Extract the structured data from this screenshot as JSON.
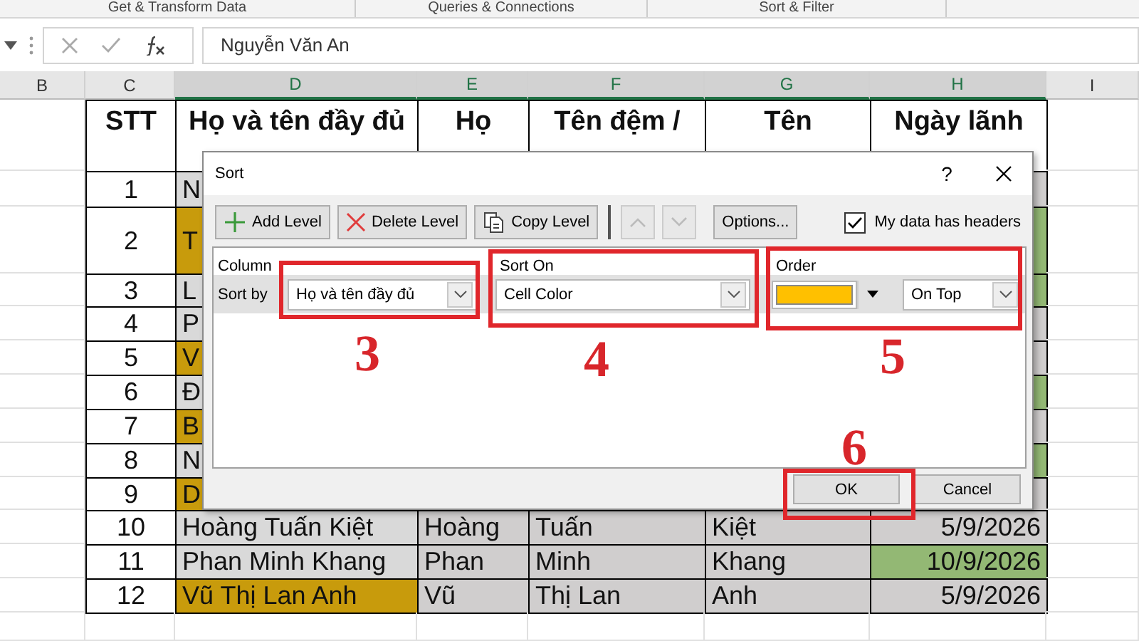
{
  "ribbon_groups": [
    "Get & Transform Data",
    "Queries & Connections",
    "Sort & Filter"
  ],
  "formula_bar": {
    "value": "Nguyễn Văn An"
  },
  "column_headers": [
    "B",
    "C",
    "D",
    "E",
    "F",
    "G",
    "H",
    "I"
  ],
  "table": {
    "header": [
      "STT",
      "Họ và tên đầy đủ",
      "Họ",
      "Tên đệm /",
      "Tên",
      "Ngày lãnh"
    ],
    "rows": [
      {
        "stt": "1",
        "name": {
          "text": "N",
          "color": "#d9d9d9"
        },
        "date": {
          "color": "#d0cece"
        }
      },
      {
        "stt": "2",
        "name": {
          "text": "T",
          "color": "#c89b0c"
        },
        "date": {
          "color": "#93b874"
        }
      },
      {
        "stt": "3",
        "name": {
          "text": "L",
          "color": "#d9d9d9"
        },
        "date": {
          "color": "#93b874"
        }
      },
      {
        "stt": "4",
        "name": {
          "text": "P",
          "color": "#d9d9d9"
        },
        "date": {
          "color": "#d0cece"
        }
      },
      {
        "stt": "5",
        "name": {
          "text": "V",
          "color": "#c89b0c"
        },
        "date": {
          "color": "#d0cece"
        }
      },
      {
        "stt": "6",
        "name": {
          "text": "Đ",
          "color": "#d9d9d9"
        },
        "date": {
          "color": "#93b874"
        }
      },
      {
        "stt": "7",
        "name": {
          "text": "B",
          "color": "#c89b0c"
        },
        "date": {
          "color": "#d0cece"
        }
      },
      {
        "stt": "8",
        "name": {
          "text": "N",
          "color": "#d9d9d9"
        },
        "date": {
          "color": "#93b874"
        }
      },
      {
        "stt": "9",
        "name": {
          "text": "D",
          "color": "#c89b0c"
        },
        "date": {
          "color": "#d0cece"
        }
      },
      {
        "stt": "10",
        "name": {
          "text": "Hoàng Tuấn Kiệt",
          "color": "#d9d9d9"
        },
        "ho": "Hoàng",
        "ten_dem": "Tuấn",
        "ten": "Kiệt",
        "date": {
          "text": "5/9/2026",
          "color": "#d0cece"
        }
      },
      {
        "stt": "11",
        "name": {
          "text": "Phan Minh Khang",
          "color": "#d9d9d9"
        },
        "ho": "Phan",
        "ten_dem": "Minh",
        "ten": "Khang",
        "date": {
          "text": "10/9/2026",
          "color": "#93b874"
        }
      },
      {
        "stt": "12",
        "name": {
          "text": "Vũ Thị Lan Anh",
          "color": "#c89b0c"
        },
        "ho": "Vũ",
        "ten_dem": "Thị Lan",
        "ten": "Anh",
        "date": {
          "text": "5/9/2026",
          "color": "#d0cece"
        }
      }
    ]
  },
  "sort_dialog": {
    "title": "Sort",
    "help": "?",
    "buttons": [
      {
        "kind": "add",
        "label": "Add Level"
      },
      {
        "kind": "delete",
        "label": "Delete Level"
      },
      {
        "kind": "copy",
        "label": "Copy Level"
      },
      {
        "kind": "up",
        "disabled": true
      },
      {
        "kind": "down",
        "disabled": true
      },
      {
        "kind": "options",
        "label": "Options..."
      }
    ],
    "headers_checkbox": {
      "label": "My data has headers",
      "checked": true
    },
    "columns": [
      "Column",
      "Sort On",
      "Order"
    ],
    "levels": [
      {
        "label": "Sort by",
        "column": "Họ và tên đầy đủ",
        "sort_on": "Cell Color",
        "color": "#ffc000",
        "order": "On Top",
        "selected": true
      }
    ],
    "ok": "OK",
    "cancel": "Cancel"
  },
  "annotations": [
    "3",
    "4",
    "5",
    "6"
  ]
}
